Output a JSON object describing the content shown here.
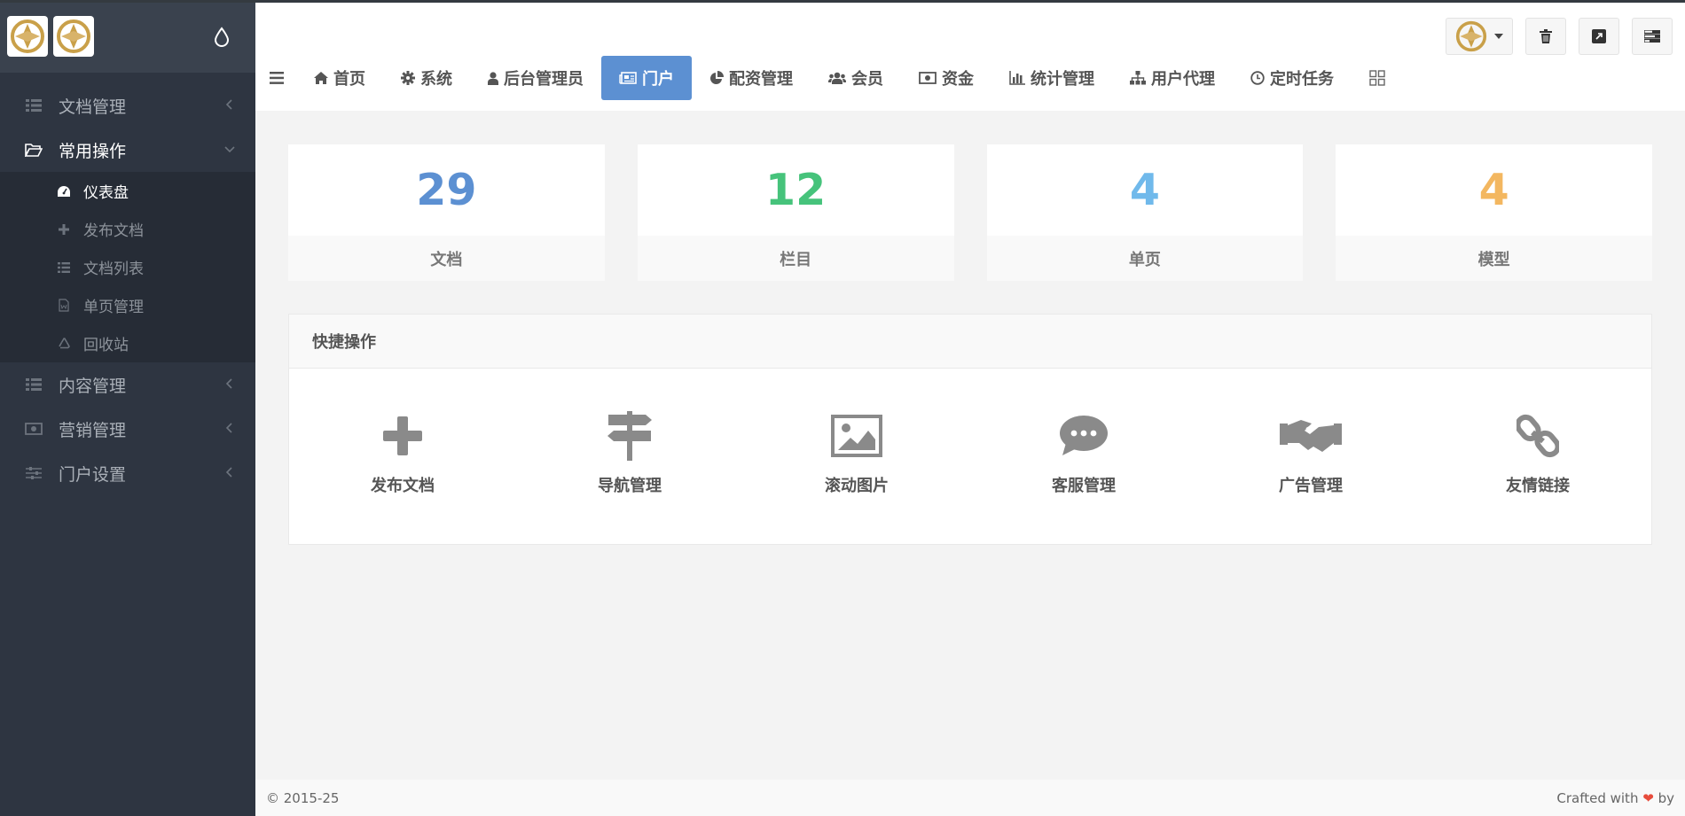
{
  "sidebar": {
    "menu": [
      {
        "label": "文档管理"
      },
      {
        "label": "常用操作"
      },
      {
        "label": "内容管理"
      },
      {
        "label": "营销管理"
      },
      {
        "label": "门户设置"
      }
    ],
    "submenu": [
      {
        "label": "仪表盘"
      },
      {
        "label": "发布文档"
      },
      {
        "label": "文档列表"
      },
      {
        "label": "单页管理"
      },
      {
        "label": "回收站"
      }
    ]
  },
  "nav": {
    "tabs": [
      {
        "label": "首页"
      },
      {
        "label": "系统"
      },
      {
        "label": "后台管理员"
      },
      {
        "label": "门户"
      },
      {
        "label": "配资管理"
      },
      {
        "label": "会员"
      },
      {
        "label": "资金"
      },
      {
        "label": "统计管理"
      },
      {
        "label": "用户代理"
      },
      {
        "label": "定时任务"
      }
    ]
  },
  "stats": [
    {
      "value": "29",
      "label": "文档",
      "color": "#5c90d2"
    },
    {
      "value": "12",
      "label": "栏目",
      "color": "#46c37b"
    },
    {
      "value": "4",
      "label": "单页",
      "color": "#70b9eb"
    },
    {
      "value": "4",
      "label": "模型",
      "color": "#f3b760"
    }
  ],
  "quick": {
    "title": "快捷操作",
    "items": [
      {
        "label": "发布文档",
        "icon": "plus-icon"
      },
      {
        "label": "导航管理",
        "icon": "signpost-icon"
      },
      {
        "label": "滚动图片",
        "icon": "image-icon"
      },
      {
        "label": "客服管理",
        "icon": "chat-icon"
      },
      {
        "label": "广告管理",
        "icon": "handshake-icon"
      },
      {
        "label": "友情链接",
        "icon": "link-icon"
      }
    ]
  },
  "footer": {
    "copyright": "© 2015-25",
    "crafted_prefix": "Crafted with",
    "crafted_suffix": "by"
  },
  "colors": {
    "accent": "#5c90d2",
    "sidebar": "#2e3541"
  }
}
